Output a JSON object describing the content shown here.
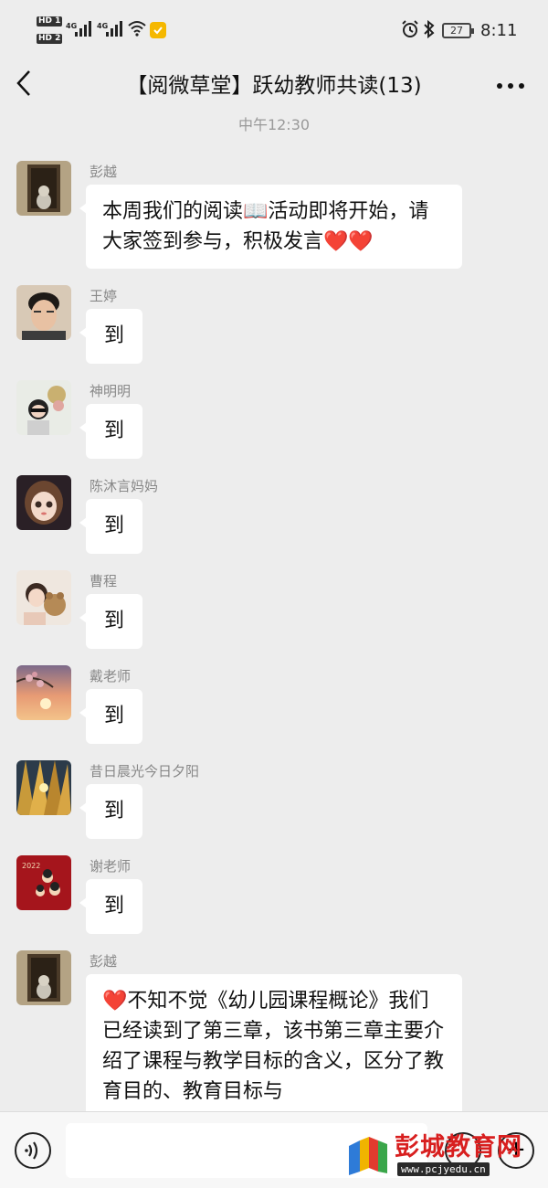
{
  "status_bar": {
    "hd1": "HD 1",
    "hd2": "HD 2",
    "sig1": "4G",
    "sig2": "4G",
    "battery": "27",
    "time": "8:11"
  },
  "nav": {
    "back_icon": "chevron-left-icon",
    "title": "【阅微草堂】跃幼教师共读(13)",
    "more_icon": "more-dots-icon"
  },
  "timestamp": "中午12:30",
  "messages": [
    {
      "sender": "彭越",
      "text": "本周我们的阅读📖活动即将开始，请大家签到参与，积极发言❤️❤️"
    },
    {
      "sender": "王婷",
      "text": "到"
    },
    {
      "sender": "神明明",
      "text": "到"
    },
    {
      "sender": "陈沐言妈妈",
      "text": "到"
    },
    {
      "sender": "曹程",
      "text": "到"
    },
    {
      "sender": "戴老师",
      "text": "到"
    },
    {
      "sender": "昔日晨光今日夕阳",
      "text": "到"
    },
    {
      "sender": "谢老师",
      "text": "到"
    },
    {
      "sender": "彭越",
      "text": "❤️不知不觉《幼儿园课程概论》我们已经读到了第三章，该书第三章主要介绍了课程与教学目标的含义，区分了教育目的、教育目标与"
    }
  ],
  "avatar_labels": {
    "m7": "2022"
  },
  "input_bar": {
    "voice_icon": "voice-icon",
    "emoji_icon": "emoji-icon",
    "plus_icon": "plus-icon"
  },
  "watermark": {
    "name": "彭城教育网",
    "url": "www.pcjyedu.cn"
  }
}
